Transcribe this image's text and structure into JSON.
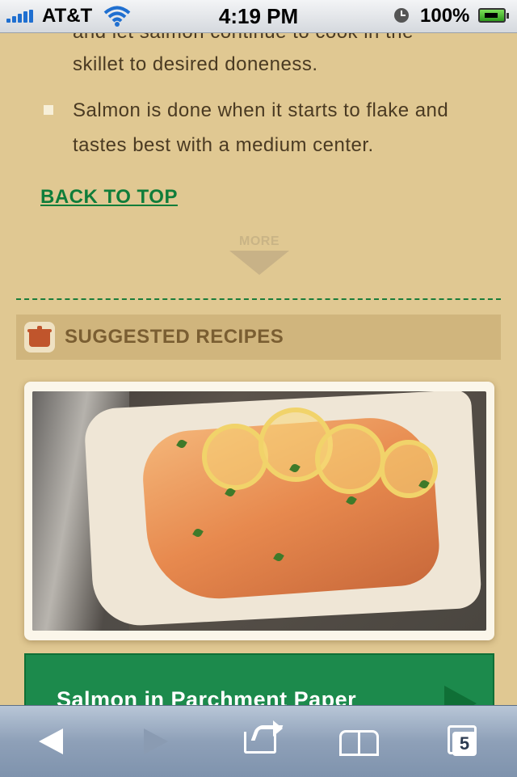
{
  "status_bar": {
    "carrier": "AT&T",
    "time": "4:19 PM",
    "battery": "100%"
  },
  "article": {
    "cut_line": "and let salmon continue to cook in the",
    "line_continued": "skillet to desired doneness.",
    "bullet_text": "Salmon is done when it starts to flake and tastes best with a medium center.",
    "back_to_top": "BACK TO TOP",
    "more_label": "MORE"
  },
  "suggested": {
    "title": "SUGGESTED RECIPES",
    "icon": "pot-icon",
    "recipe_title": "Salmon in Parchment Paper"
  },
  "toolbar": {
    "icons": [
      "back-icon",
      "forward-icon",
      "share-icon",
      "bookmarks-icon",
      "tabs-icon"
    ],
    "tab_count": "5"
  }
}
